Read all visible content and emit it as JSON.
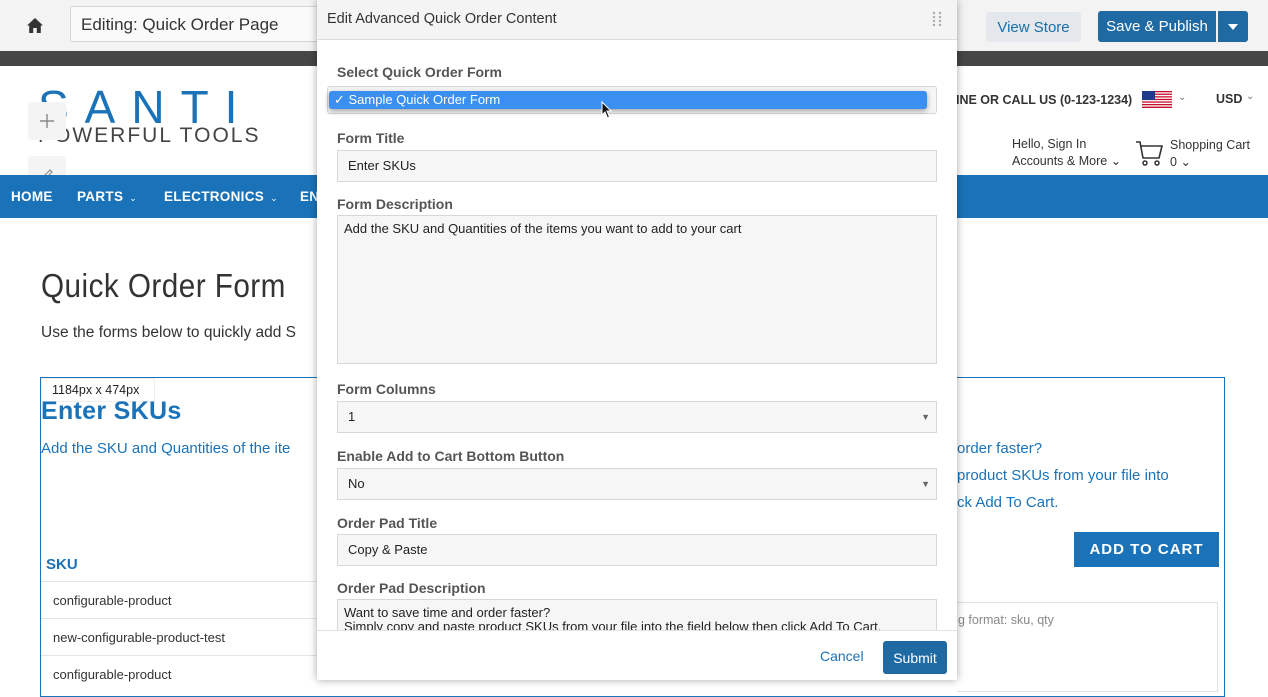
{
  "editor": {
    "editing_title": "Editing: Quick Order Page",
    "view_store": "View Store",
    "save_publish": "Save & Publish",
    "home_icon": "home-icon",
    "caret_icon": "caret-down-icon"
  },
  "store": {
    "logo_top": "SANTI",
    "logo_bottom": "POWERFUL TOOLS",
    "call_us": "INE OR CALL US (0-123-1234)",
    "currency": "USD",
    "sign_in": "Hello, Sign In",
    "accounts": "Accounts & More",
    "cart_label": "Shopping Cart",
    "cart_count": "0",
    "nav": [
      "HOME",
      "PARTS",
      "ELECTRONICS",
      "EN"
    ],
    "page_title": "Quick Order Form",
    "page_sub": "Use the forms below to quickly add S",
    "dimensions": "1184px x 474px",
    "form_heading": "Enter SKUs",
    "form_desc": "Add the SKU and Quantities of the ite",
    "sku_header": "SKU",
    "sku_rows": [
      "configurable-product",
      "new-configurable-product-test",
      "configurable-product"
    ],
    "pad_lines": [
      "order faster?",
      "product SKUs from your file into",
      "ck Add To Cart."
    ],
    "add_to_cart": "ADD TO CART",
    "pad_placeholder": "g format: sku, qty",
    "accent_color": "#1a73b8"
  },
  "modal": {
    "title": "Edit Advanced Quick Order Content",
    "select_label": "Select Quick Order Form",
    "select_option": "✓ Sample Quick Order Form",
    "form_title_label": "Form Title",
    "form_title_value": "Enter SKUs",
    "form_desc_label": "Form Description",
    "form_desc_value": "Add the SKU and Quantities of the items you want to add to your cart",
    "columns_label": "Form Columns",
    "columns_value": "1",
    "bottom_btn_label": "Enable Add to Cart Bottom Button",
    "bottom_btn_value": "No",
    "pad_title_label": "Order Pad Title",
    "pad_title_value": "Copy & Paste",
    "pad_desc_label": "Order Pad Description",
    "pad_desc_value": "Want to save time and order faster?\nSimply copy and paste product SKUs from your file into the field below then click Add To Cart.",
    "cancel": "Cancel",
    "submit": "Submit"
  }
}
